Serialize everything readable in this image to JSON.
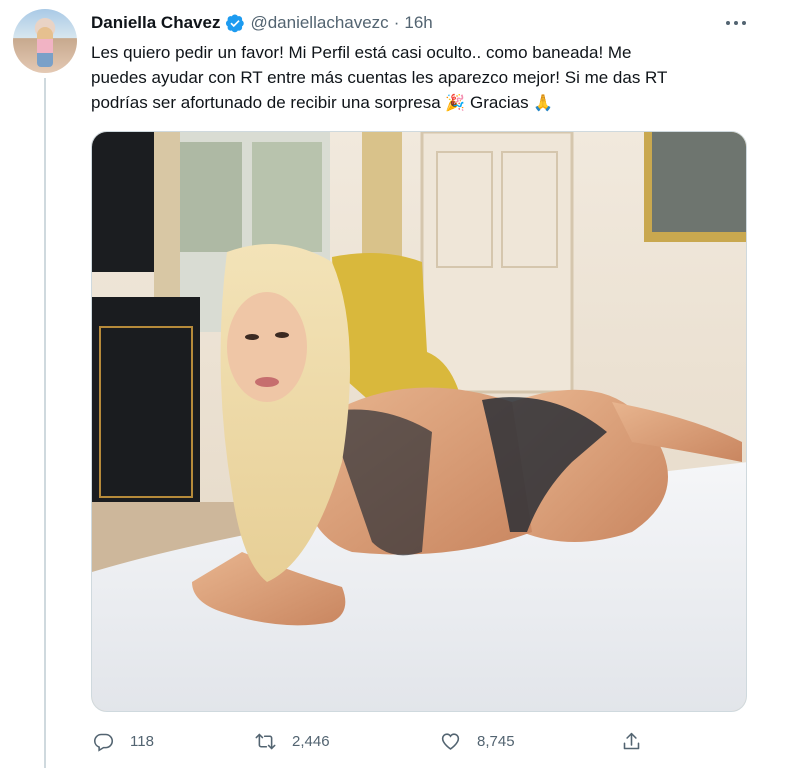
{
  "author": {
    "name": "Daniella Chavez",
    "handle": "@daniellachavezc",
    "separator": "·",
    "time": "16h"
  },
  "tweet": {
    "line1": "Les quiero pedir un favor! Mi Perfil está casi oculto.. como baneada! Me",
    "line2": "puedes ayudar con RT entre más cuentas les aparezco mejor!  Si me das RT",
    "line3_text": "podrías ser afortunado de recibir una sorpresa ",
    "line3_emoji1": "🎉",
    "line3_text2": " Gracias ",
    "line3_emoji2": "🙏"
  },
  "media": {
    "description_icon": "photo"
  },
  "actions": {
    "reply_count": "118",
    "retweet_count": "2,446",
    "like_count": "8,745"
  },
  "icons": {
    "verified": "verified-badge-icon",
    "more": "more-icon",
    "reply": "reply-icon",
    "retweet": "retweet-icon",
    "like": "like-icon",
    "share": "share-icon"
  },
  "colors": {
    "verified": "#1d9bf0",
    "text": "#0f1419",
    "secondary": "#536471",
    "border": "#cfd9de"
  }
}
